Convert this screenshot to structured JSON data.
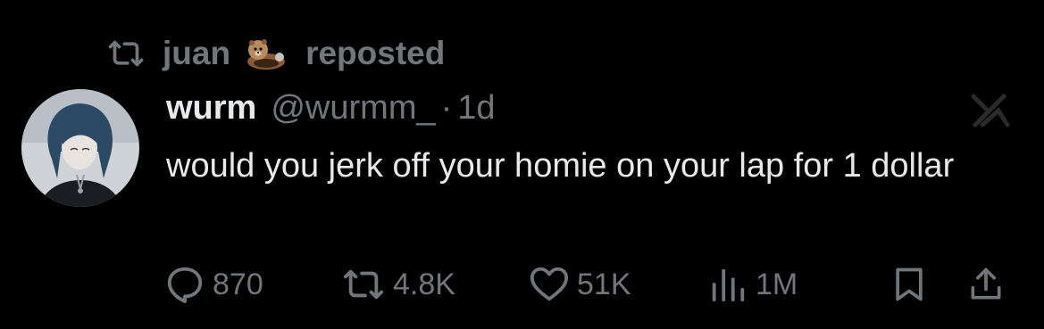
{
  "repost_banner": {
    "user": "juan",
    "emoji_icon": "otter-emoji",
    "action": "reposted",
    "icon": "repost-icon"
  },
  "tweet": {
    "display_name": "wurm",
    "handle": "@wurmm_",
    "separator": "·",
    "time": "1d",
    "text": "would you jerk off your homie on your lap for 1 dollar",
    "corner_icon": "grok-icon"
  },
  "actions": {
    "reply": {
      "icon": "comment-icon",
      "count": "870"
    },
    "repost": {
      "icon": "repost-icon",
      "count": "4.8K"
    },
    "like": {
      "icon": "heart-icon",
      "count": "51K"
    },
    "views": {
      "icon": "views-bar-chart-icon",
      "count": "1M"
    },
    "bookmark": {
      "icon": "bookmark-icon"
    },
    "share": {
      "icon": "share-icon"
    }
  },
  "colors": {
    "background": "#000000",
    "primary_text": "#e7e9ea",
    "secondary_text": "#71767b"
  }
}
